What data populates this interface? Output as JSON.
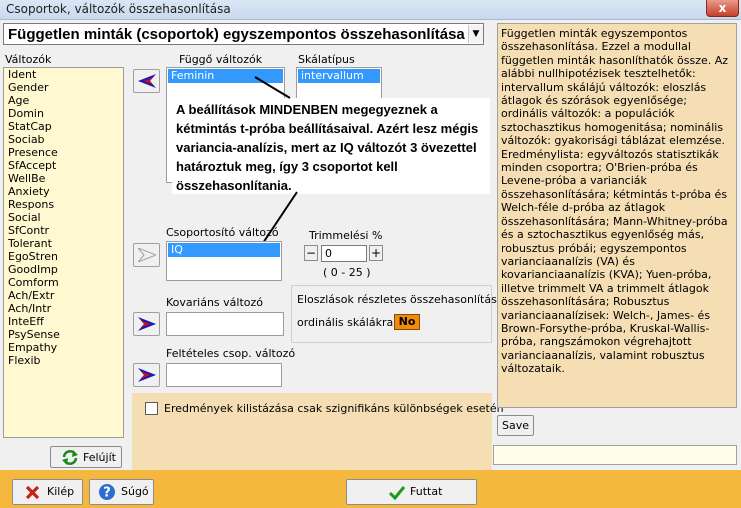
{
  "window": {
    "title": "Csoportok, változók összehasonlítása",
    "close_label": "x"
  },
  "selector": {
    "value": "Független minták (csoportok) egyszempontos összehasonlítása"
  },
  "variables": {
    "label": "Változók",
    "items": [
      "Ident",
      "Gender",
      "Age",
      "Domin",
      "StatCap",
      "Sociab",
      "Presence",
      "SfAccept",
      "WellBe",
      "Anxiety",
      "Respons",
      "Social",
      "SfContr",
      "Tolerant",
      "EgoStren",
      "GoodImp",
      "Comform",
      "Ach/Extr",
      "Ach/Intr",
      "InteEff",
      "PsySense",
      "Empathy",
      "Flexib"
    ]
  },
  "dependent": {
    "label": "Függő változók",
    "items": [
      "Feminin"
    ]
  },
  "scale": {
    "label": "Skálatípus",
    "items": [
      "intervallum"
    ]
  },
  "callout": {
    "text": "A beállítások MINDENBEN megegyeznek a kétmintás t-próba beállításaival. Azért lesz mégis variancia-analízis, mert az IQ változót 3 övezettel határoztuk meg, így 3 csoportot kell összehasonlítania."
  },
  "grouping": {
    "label": "Csoportosító változó",
    "items": [
      "IQ"
    ]
  },
  "trimming": {
    "label": "Trimmelési %",
    "minus": "−",
    "plus": "+",
    "value": "0",
    "range": "( 0 - 25 )"
  },
  "covariate": {
    "label": "Kovariáns változó"
  },
  "conditional": {
    "label": "Feltételes csop. változó"
  },
  "distribution": {
    "title": "Eloszlások részletes összehasonlítása",
    "ordinal_label": "ordinális skálákra:",
    "ordinal_value": "No"
  },
  "option": {
    "label": "Eredmények kilistázása csak szignifikáns különbségek esetén",
    "checked": false
  },
  "help": {
    "text": "Független minták egyszempontos összehasonlítása. Ezzel a modullal független minták hasonlíthatók össze. Az alábbi nullhipotézisek tesztelhetők: intervallum skálájú változók: eloszlás átlagok és szórások egyenlősége; ordinális változók: a populációk sztochasztikus homogenitása; nominális változók: gyakorisági táblázat elemzése. Eredménylista: egyváltozós statisztikák minden csoportra; O'Brien-próba és Levene-próba a varianciák összehasonlítására; kétmintás t-próba és Welch-féle d-próba az átlagok összehasonlítására; Mann-Whitney-próba és a sztochasztikus egyenlőség más, robusztus próbái; egyszempontos varianciaanalízis (VA) és kovarianciaanalízis (KVA); Yuen-próba, illetve trimmelt VA a trimmelt átlagok összehasonlítására; Robusztus varianciaanalízisek: Welch-, James- és Brown-Forsythe-próba, Kruskal-Wallis-próba, rangszámokon végrehajtott varianciaanalízis, valamint robusztus változataik."
  },
  "buttons": {
    "refresh": "Felújít",
    "save": "Save",
    "exit": "Kilép",
    "help": "Súgó",
    "run": "Futtat"
  },
  "colors": {
    "list_bg": "#fff8d0",
    "help_bg": "#f5deb3",
    "selection": "#3399ff",
    "bottom_bar": "#f5b83f",
    "badge": "#f28b0c",
    "arrow_blue": "#1a1ab0",
    "arrow_red": "#d01010"
  }
}
